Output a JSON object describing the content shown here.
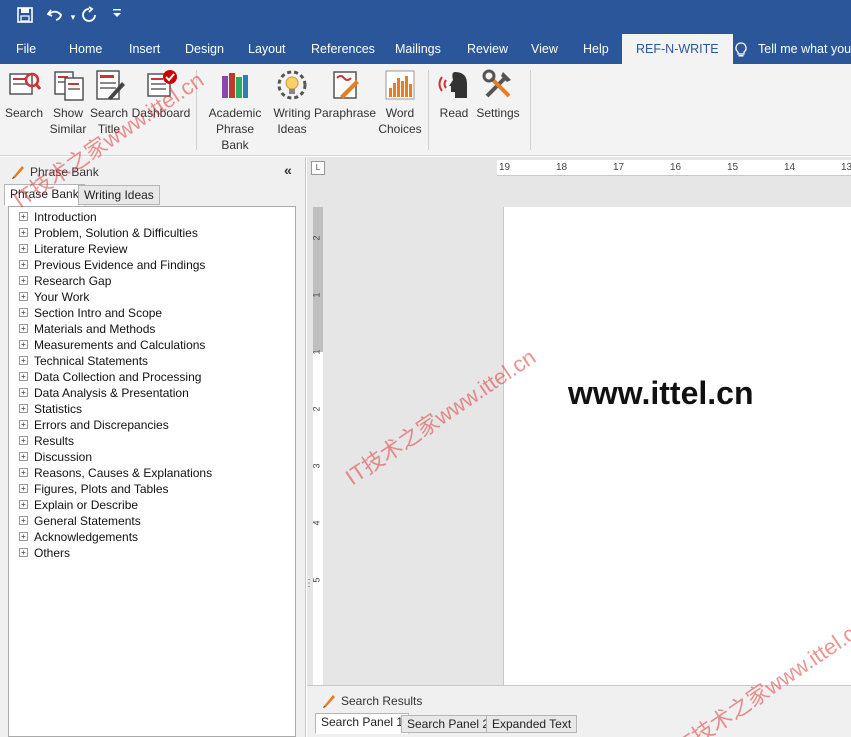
{
  "quick_access": {
    "save_icon": "save-icon",
    "undo_icon": "undo-icon",
    "redo_icon": "redo-icon",
    "customize_icon": "customize-qat-icon"
  },
  "tabs": [
    {
      "label": "File"
    },
    {
      "label": "Home"
    },
    {
      "label": "Insert"
    },
    {
      "label": "Design"
    },
    {
      "label": "Layout"
    },
    {
      "label": "References"
    },
    {
      "label": "Mailings"
    },
    {
      "label": "Review"
    },
    {
      "label": "View"
    },
    {
      "label": "Help"
    },
    {
      "label": "REF-N-WRITE"
    }
  ],
  "tell_me": "Tell me what you",
  "ribbon": {
    "search": "Search",
    "show_similar_1": "Show",
    "show_similar_2": "Similar",
    "search_title_1": "Search",
    "search_title_2": "Title",
    "dashboard": "Dashboard",
    "academic_1": "Academic",
    "academic_2": "Phrase Bank",
    "writing_ideas_1": "Writing",
    "writing_ideas_2": "Ideas",
    "paraphrase": "Paraphrase",
    "word_choices_1": "Word",
    "word_choices_2": "Choices",
    "read": "Read",
    "settings": "Settings"
  },
  "phrase_bank": {
    "title": "Phrase Bank",
    "collapse": "«",
    "tabs": [
      "Phrase Bank",
      "Writing Ideas"
    ],
    "items": [
      "Introduction",
      "Problem, Solution & Difficulties",
      "Literature Review",
      "Previous Evidence and Findings",
      "Research Gap",
      "Your Work",
      "Section Intro and Scope",
      "Materials and Methods",
      "Measurements and Calculations",
      "Technical Statements",
      "Data Collection and Processing",
      "Data Analysis & Presentation",
      "Statistics",
      "Errors and Discrepancies",
      "Results",
      "Discussion",
      "Reasons, Causes & Explanations",
      "Figures, Plots and Tables",
      "Explain or Describe",
      "General Statements",
      "Acknowledgements",
      "Others"
    ]
  },
  "ruler": {
    "h_ticks": [
      "19",
      "18",
      "17",
      "16",
      "15",
      "14",
      "13"
    ],
    "v_ticks": [
      "2",
      "1",
      "1",
      "2",
      "3",
      "4",
      "5"
    ],
    "corner": "L"
  },
  "document": {
    "text": "www.ittel.cn"
  },
  "search_results": {
    "title": "Search Results",
    "tabs": [
      "Search Panel 1",
      "Search Panel 2",
      "Expanded Text"
    ]
  },
  "watermarks": [
    "IT技术之家www.ittel.cn",
    "IT技术之家www.ittel.cn",
    "IT技术之家www.ittel.cn"
  ]
}
